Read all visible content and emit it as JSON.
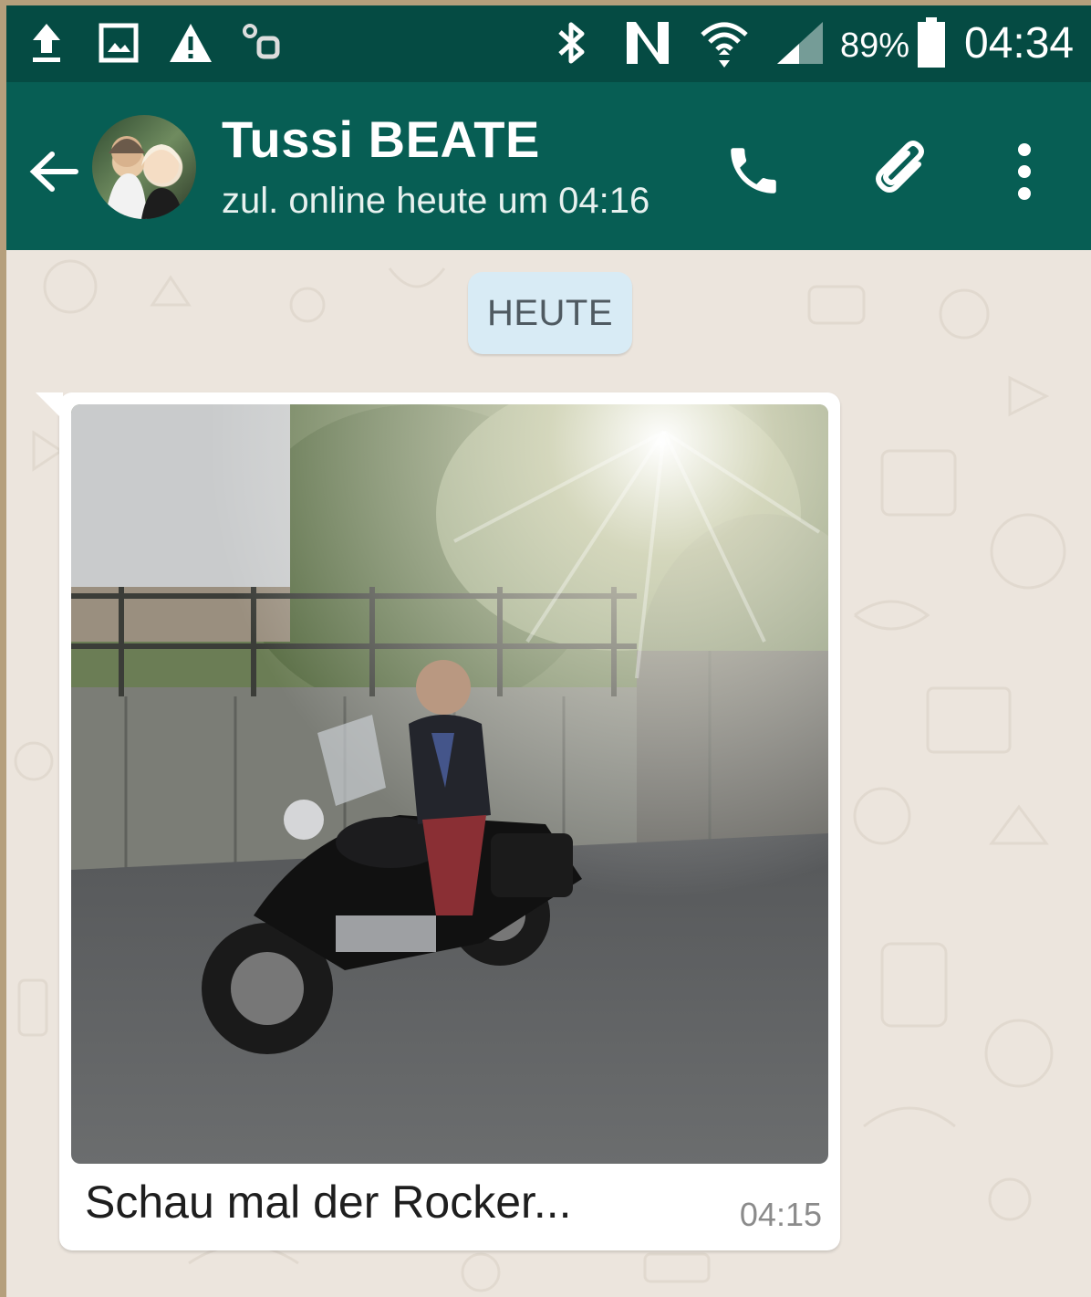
{
  "status_bar": {
    "battery_percent": "89%",
    "time": "04:34",
    "icons": [
      "upload-icon",
      "gallery-icon",
      "warning-icon",
      "pokemon-go-icon",
      "bluetooth-icon",
      "nfc-icon",
      "wifi-icon",
      "signal-icon",
      "battery-icon"
    ]
  },
  "header": {
    "contact_name": "Tussi BEATE",
    "last_seen": "zul. online heute um 04:16",
    "icons": [
      "back-arrow-icon",
      "call-icon",
      "attach-icon",
      "more-icon"
    ]
  },
  "chat": {
    "date_separator": "HEUTE",
    "messages": [
      {
        "type": "image",
        "caption": "Schau mal der Rocker...",
        "time": "04:15"
      }
    ]
  },
  "colors": {
    "status_bar": "#054b43",
    "app_bar": "#075e54",
    "chat_background": "#ece5dd",
    "date_pill": "#d8ebf5"
  }
}
